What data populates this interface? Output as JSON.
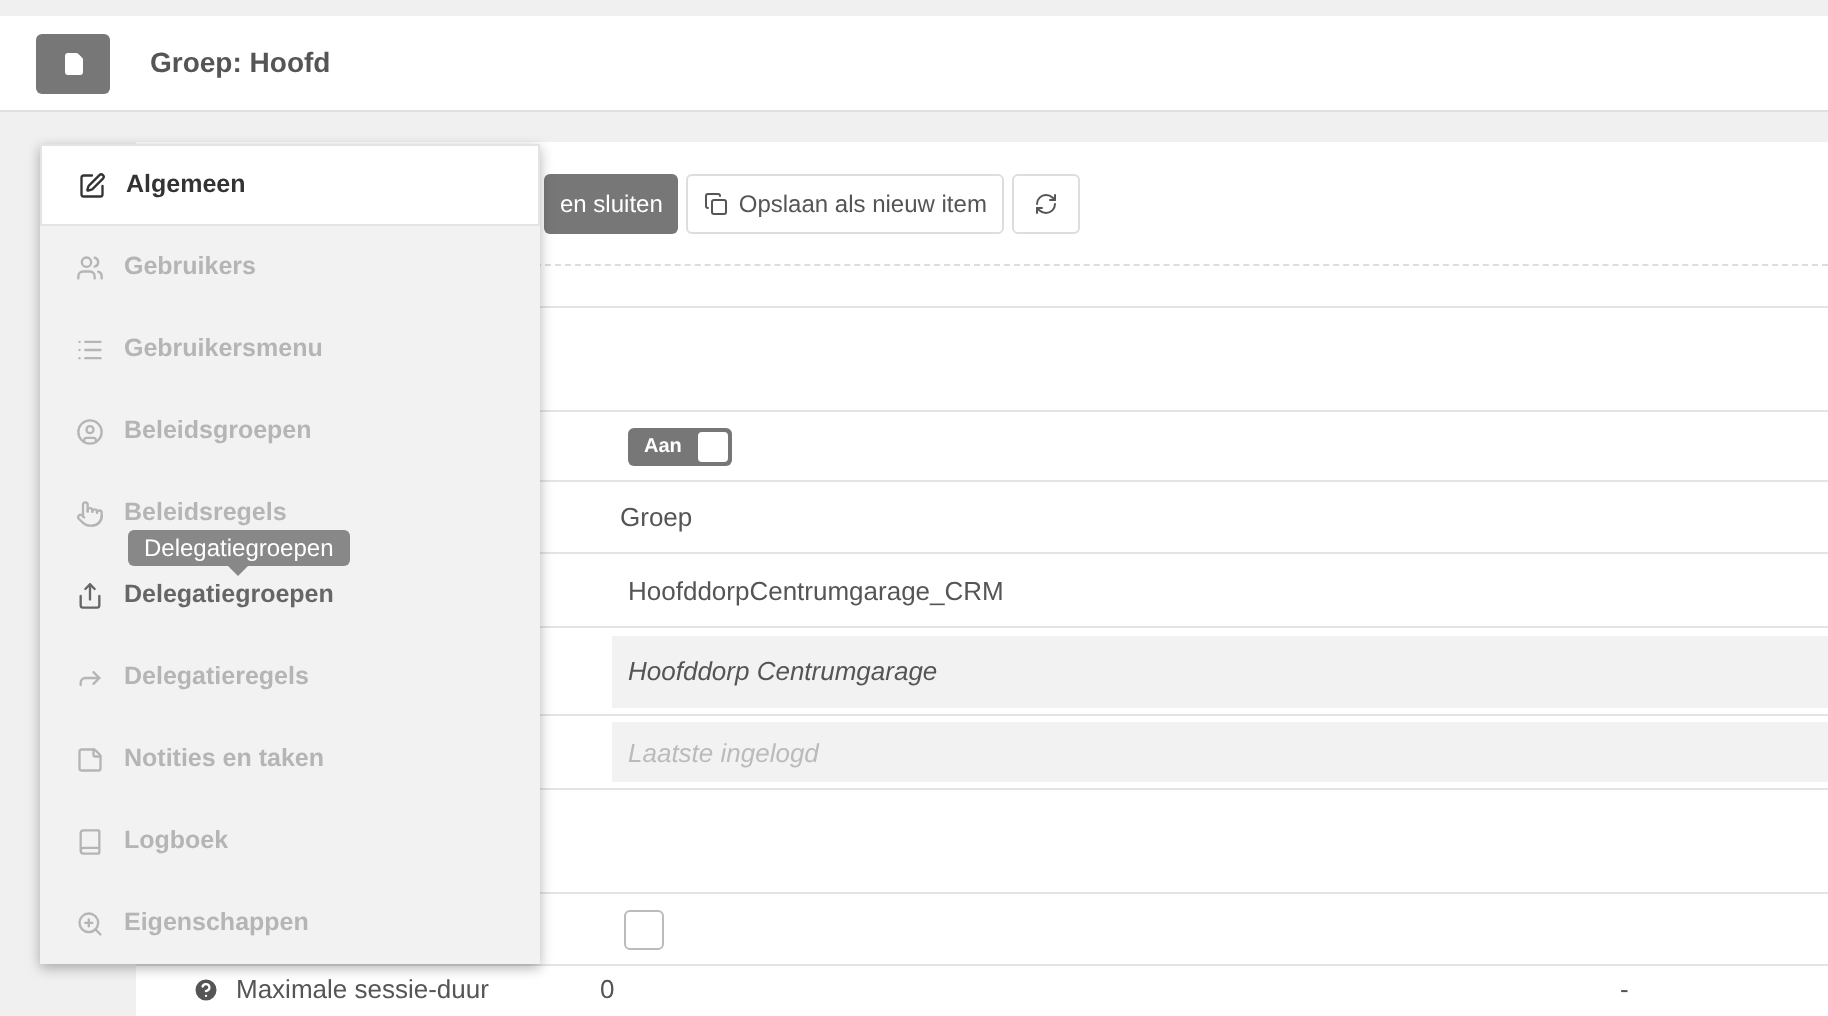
{
  "header": {
    "title": "Groep: Hoofd"
  },
  "toolbar": {
    "buttons": [
      {
        "kind": "primary",
        "label": "en sluiten"
      },
      {
        "kind": "copy",
        "label": "Opslaan als nieuw item"
      },
      {
        "kind": "refresh"
      }
    ]
  },
  "form": {
    "rows": [
      {
        "kind": "section"
      },
      {
        "kind": "toggle",
        "label": "Aan",
        "on": true
      },
      {
        "kind": "text",
        "value": "Groep"
      },
      {
        "kind": "input",
        "value": "HoofddorpCentrumgarage_CRM"
      },
      {
        "kind": "readonly",
        "value": "Hoofddorp Centrumgarage"
      },
      {
        "kind": "input",
        "placeholder": "Laatste ingelogd"
      },
      {
        "kind": "section"
      },
      {
        "kind": "checkbox",
        "checked": false
      },
      {
        "kind": "help",
        "label": "Maximale sessie-duur",
        "value": "0",
        "extra": "-"
      }
    ]
  },
  "menu": {
    "tooltip": "Delegatiegroepen",
    "items": [
      {
        "label": "Algemeen",
        "selected": true,
        "hovered": false
      },
      {
        "label": "Gebruikers",
        "selected": false,
        "hovered": false
      },
      {
        "label": "Gebruikersmenu",
        "selected": false,
        "hovered": false
      },
      {
        "label": "Beleidsgroepen",
        "selected": false,
        "hovered": false
      },
      {
        "label": "Beleidsregels",
        "selected": false,
        "hovered": false
      },
      {
        "label": "Delegatiegroepen",
        "selected": false,
        "hovered": true
      },
      {
        "label": "Delegatieregels",
        "selected": false,
        "hovered": false
      },
      {
        "label": "Notities en taken",
        "selected": false,
        "hovered": false
      },
      {
        "label": "Logboek",
        "selected": false,
        "hovered": false
      },
      {
        "label": "Eigenschappen",
        "selected": false,
        "hovered": false
      }
    ]
  }
}
